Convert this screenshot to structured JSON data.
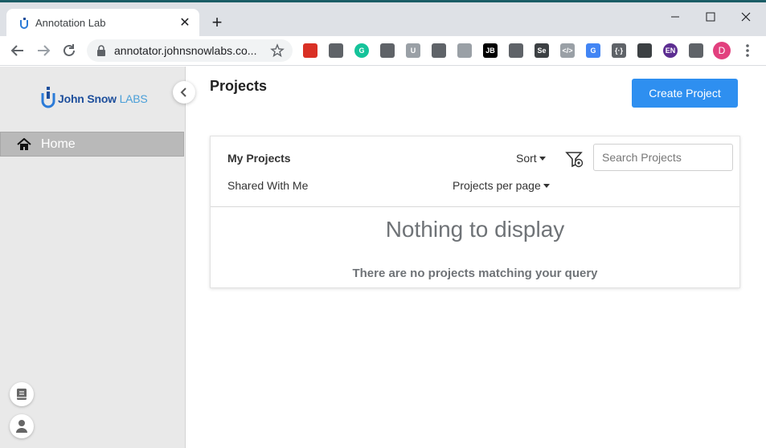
{
  "browser": {
    "tab_title": "Annotation Lab",
    "url": "annotator.johnsnowlabs.co...",
    "profile_initial": "D",
    "extensions": [
      {
        "name": "recorder-extension-icon",
        "color": "#d93025",
        "text": ""
      },
      {
        "name": "search-person-extension-icon",
        "color": "#5f6368",
        "text": ""
      },
      {
        "name": "grammarly-extension-icon",
        "color": "#15c39a",
        "text": "G"
      },
      {
        "name": "circle-extension-icon",
        "color": "#5f6368",
        "text": ""
      },
      {
        "name": "u-extension-icon",
        "color": "#9aa0a6",
        "text": "U"
      },
      {
        "name": "speedometer-extension-icon",
        "color": "#5f6368",
        "text": ""
      },
      {
        "name": "notepad-extension-icon",
        "color": "#9aa0a6",
        "text": ""
      },
      {
        "name": "jb-extension-icon",
        "color": "#000000",
        "text": "JB"
      },
      {
        "name": "gear-extension-icon",
        "color": "#5f6368",
        "text": ""
      },
      {
        "name": "selenium-extension-icon",
        "color": "#3c4043",
        "text": "Se"
      },
      {
        "name": "code-extension-icon",
        "color": "#9aa0a6",
        "text": "</>"
      },
      {
        "name": "translate-extension-icon",
        "color": "#4285f4",
        "text": "G"
      },
      {
        "name": "brackets-extension-icon",
        "color": "#5f6368",
        "text": "{·}"
      },
      {
        "name": "qr-extension-icon",
        "color": "#3c4043",
        "text": ""
      },
      {
        "name": "en-extension-icon",
        "color": "#5c2d91",
        "text": "EN"
      },
      {
        "name": "puzzle-extension-icon",
        "color": "#5f6368",
        "text": ""
      }
    ]
  },
  "sidebar": {
    "logo_bold": "John Snow",
    "logo_light": " LABS",
    "home_label": "Home"
  },
  "main": {
    "title": "Projects",
    "create_button": "Create Project",
    "tabs": [
      "My Projects",
      "Shared With Me"
    ],
    "sort_label": "Sort",
    "per_page_label": "Projects per page",
    "search_placeholder": "Search Projects",
    "empty_title": "Nothing to display",
    "empty_subtitle": "There are no projects matching your query"
  },
  "colors": {
    "primary": "#2e8ff0",
    "sidebar_bg": "#e9e9e9",
    "nav_active": "#b9b9b9"
  }
}
